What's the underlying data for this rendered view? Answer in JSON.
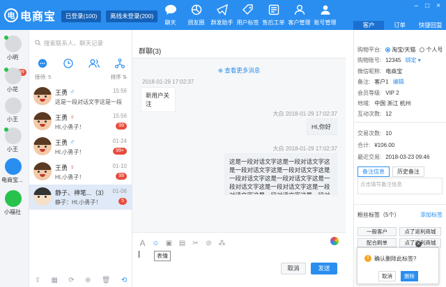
{
  "app": {
    "logo_symbol": "电",
    "logo_name": "电商宝"
  },
  "header": {
    "logged_in": "已登录(100)",
    "offline": "离线未登录(200)",
    "tools": [
      {
        "label": "聊天",
        "icon": "chat-icon"
      },
      {
        "label": "朋友圈",
        "icon": "moments-icon"
      },
      {
        "label": "群发助手",
        "icon": "broadcast-icon"
      },
      {
        "label": "用户标签",
        "icon": "tag-icon"
      },
      {
        "label": "售后工单",
        "icon": "worksheet-icon"
      },
      {
        "label": "客户管理",
        "icon": "customer-icon"
      },
      {
        "label": "账号管理",
        "icon": "account-icon"
      }
    ],
    "window_controls": [
      "–",
      "□",
      "×"
    ],
    "right_tabs": [
      "客户",
      "订单",
      "快捷回复"
    ]
  },
  "left_accounts": [
    {
      "name": "小明",
      "badge": "99"
    },
    {
      "name": "小花",
      "badge": ""
    },
    {
      "name": "小王",
      "badge": ""
    },
    {
      "name": "小王",
      "badge": ""
    },
    {
      "name": "电商宝...",
      "badge": ""
    },
    {
      "name": "小福社",
      "badge": ""
    }
  ],
  "contacts": {
    "search_placeholder": "搜索联系人、聊天记录",
    "count_label": "接待: 5",
    "sort_label": "排序 ⇅",
    "items": [
      {
        "name": "王勇",
        "gender": "♂",
        "msg": "这是一段对话文字这是一段",
        "time": "15:56",
        "badge": ""
      },
      {
        "name": "王勇",
        "gender": "♀",
        "msg": "HI,小勇子！",
        "time": "15:56",
        "badge": "99"
      },
      {
        "name": "王勇",
        "gender": "♂",
        "msg": "HI,小勇子！",
        "time": "01-24",
        "badge": "99+"
      },
      {
        "name": "王勇",
        "gender": "♀",
        "msg": "HI,小勇子！",
        "time": "01-10",
        "badge": "99"
      },
      {
        "name": "静子、神笔...（3）",
        "gender": "",
        "msg": "静子：HI,小勇子！",
        "time": "01-06",
        "badge": "5"
      }
    ]
  },
  "chat": {
    "title": "群聊(3)",
    "more": "⊕ 查看更多消息",
    "messages": [
      {
        "meta": "2018-01-29 17:02:37",
        "text": "新用户关注"
      },
      {
        "meta": "大白  2018-01-29 17:02:37",
        "text": "HI,你好"
      },
      {
        "meta": "大白  2018-01-29 17:02:37",
        "text": "这是一段对话文字这是一段对话文字这是一段对话文字这是一段对话文字这是一段对话文字这是一段对话文字这是一段对话文字这是一段对话文字这是一段对话文字这是一段对话文字这是一段对话文字"
      }
    ],
    "tooltip": "表情",
    "cancel": "取消",
    "send": "发送"
  },
  "customer": {
    "platform_label": "购物平台:",
    "platform_options": [
      "淘宝/天猫",
      "个人号"
    ],
    "account_label": "购物账号:",
    "account_value": "12345",
    "bind_link": "绑定 ▾",
    "wechat_label": "微信昵称:",
    "wechat_value": "电商宝",
    "note_label": "备注:",
    "note_value": "客户1",
    "edit_link": "编辑",
    "vip_label": "会员等级:",
    "vip_value": "VIP 2",
    "region_label": "地域:",
    "region_value": "中国 浙江 杭州",
    "interact_label": "互动次数:",
    "interact_value": "12",
    "trade_label": "交易次数:",
    "trade_value": "10",
    "total_label": "合计:",
    "total_value": "¥106.00",
    "last_label": "最近交易:",
    "last_value": "2018-03-23 09:46",
    "note_tabs": [
      "备注信息",
      "历史备注"
    ],
    "note_placeholder": "点击填写备注信息",
    "fans_label": "粉丝标签（5个）",
    "add_tag": "添加标签",
    "tags": [
      "一般客户",
      "点了返利商城",
      "配合刷单",
      "点了返利商城",
      "投"
    ],
    "popup_question": "确认删除此标签?",
    "popup_cancel": "取消",
    "popup_delete": "删除"
  }
}
